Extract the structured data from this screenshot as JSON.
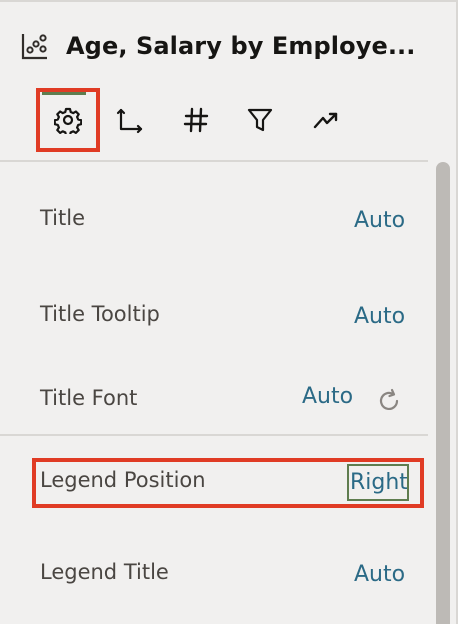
{
  "header": {
    "title": "Age, Salary by Employe...",
    "icon": "scatter-chart-icon"
  },
  "tabs": [
    {
      "name": "properties",
      "icon": "gear-icon",
      "active": true
    },
    {
      "name": "axis",
      "icon": "axis-icon",
      "active": false
    },
    {
      "name": "values",
      "icon": "hash-icon",
      "active": false
    },
    {
      "name": "filter",
      "icon": "filter-icon",
      "active": false
    },
    {
      "name": "analytics",
      "icon": "trend-icon",
      "active": false
    }
  ],
  "rows": {
    "title": {
      "label": "Title",
      "value": "Auto"
    },
    "title_tooltip": {
      "label": "Title Tooltip",
      "value": "Auto"
    },
    "title_font": {
      "label": "Title Font",
      "value": "Auto",
      "reset_icon": "reset-icon"
    },
    "legend_position": {
      "label": "Legend Position",
      "value": "Right"
    },
    "legend_title": {
      "label": "Legend Title",
      "value": "Auto"
    }
  },
  "colors": {
    "accent": "#5f7d4f",
    "highlight": "#e03b24",
    "link": "#2b6a86",
    "background": "#f1f0ef"
  }
}
